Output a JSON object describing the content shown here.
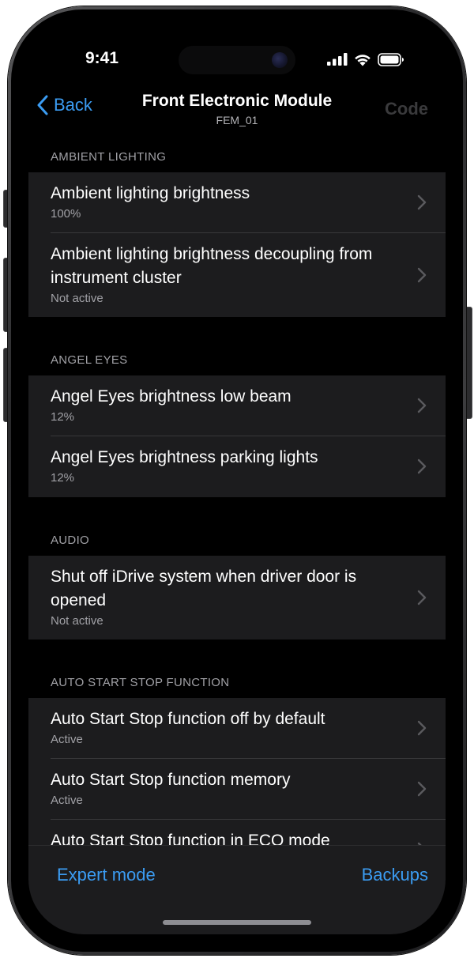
{
  "status": {
    "time": "9:41",
    "signal_icon": "signal-bars-icon",
    "wifi_icon": "wifi-icon",
    "battery_icon": "battery-icon"
  },
  "nav": {
    "back_label": "Back",
    "title": "Front Electronic Module",
    "subtitle": "FEM_01",
    "code_label": "Code"
  },
  "sections": [
    {
      "header": "AMBIENT LIGHTING",
      "rows": [
        {
          "title": "Ambient lighting brightness",
          "value": "100%"
        },
        {
          "title": "Ambient lighting brightness decoupling from instrument cluster",
          "value": "Not active"
        }
      ]
    },
    {
      "header": "ANGEL EYES",
      "rows": [
        {
          "title": "Angel Eyes brightness low beam",
          "value": "12%"
        },
        {
          "title": "Angel Eyes brightness parking lights",
          "value": "12%"
        }
      ]
    },
    {
      "header": "AUDIO",
      "rows": [
        {
          "title": "Shut off iDrive system when driver door is opened",
          "value": "Not active"
        }
      ]
    },
    {
      "header": "AUTO START STOP FUNCTION",
      "rows": [
        {
          "title": "Auto Start Stop function off by default",
          "value": "Active"
        },
        {
          "title": "Auto Start Stop function memory",
          "value": "Active"
        },
        {
          "title": "Auto Start Stop function in ECO mode",
          "value": ""
        }
      ]
    }
  ],
  "tabbar": {
    "left_label": "Expert mode",
    "right_label": "Backups"
  },
  "colors": {
    "accent": "#3b9cf2",
    "background": "#000000",
    "cell": "#1c1c1e",
    "secondary_text": "#a1a1a6",
    "disabled": "#3a3a3c"
  }
}
